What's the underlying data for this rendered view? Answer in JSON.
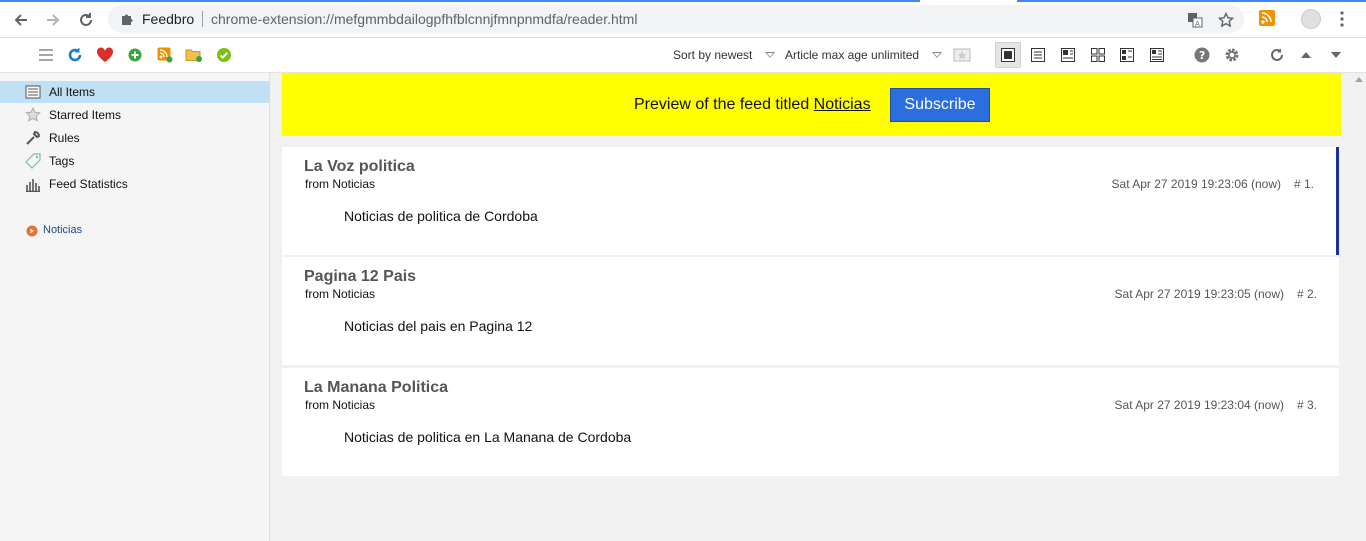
{
  "browser": {
    "site_name": "Feedbro",
    "url": "chrome-extension://mefgmmbdailogpfhfblcnnjfmnpnmdfa/reader.html"
  },
  "toolbar": {
    "sort_label": "Sort by newest",
    "max_age_label": "Article max age unlimited"
  },
  "sidebar": {
    "items": [
      {
        "label": "All Items",
        "icon": "list-icon"
      },
      {
        "label": "Starred Items",
        "icon": "star-icon"
      },
      {
        "label": "Rules",
        "icon": "wrench-icon"
      },
      {
        "label": "Tags",
        "icon": "tag-icon"
      },
      {
        "label": "Feed Statistics",
        "icon": "bar-chart-icon"
      }
    ],
    "feeds": [
      {
        "label": "Noticias",
        "icon": "feed-icon"
      }
    ]
  },
  "banner": {
    "text": "Preview of the feed titled",
    "feed_link": "Noticias",
    "subscribe_label": "Subscribe"
  },
  "articles": [
    {
      "title": "La Voz politica",
      "from": "from Noticias",
      "date": "Sat Apr 27 2019 19:23:06 (now)",
      "num": "# 1.",
      "body": "Noticias de politica de Cordoba"
    },
    {
      "title": "Pagina 12 Pais",
      "from": "from Noticias",
      "date": "Sat Apr 27 2019 19:23:05 (now)",
      "num": "# 2.",
      "body": "Noticias del pais en Pagina 12"
    },
    {
      "title": "La Manana Politica",
      "from": "from Noticias",
      "date": "Sat Apr 27 2019 19:23:04 (now)",
      "num": "# 3.",
      "body": "Noticias de politica en La Manana de Cordoba"
    }
  ],
  "colors": {
    "banner_bg": "#ffff00",
    "subscribe_bg": "#2a6ee0",
    "selected_accent": "#1c2fa0",
    "active_sidebar": "#bfe0f5"
  }
}
